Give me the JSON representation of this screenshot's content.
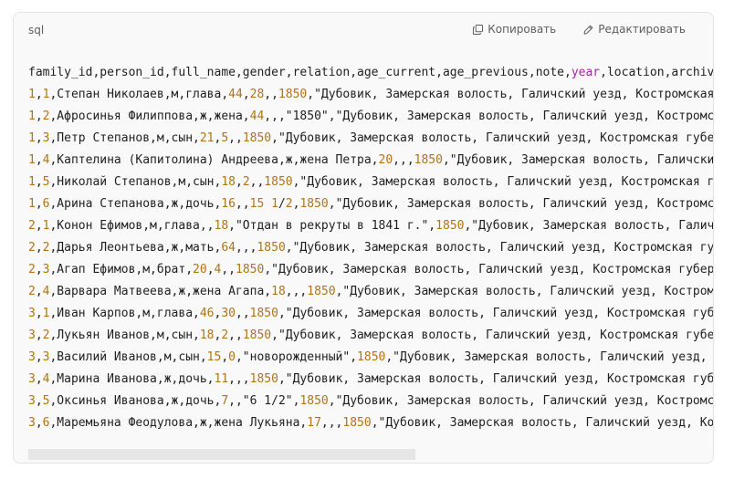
{
  "code_block": {
    "language": "sql",
    "copy_label": "Копировать",
    "edit_label": "Редактировать",
    "icons": {
      "copy": "copy-icon",
      "edit": "pencil-icon"
    },
    "colors": {
      "number": "#b07414",
      "keyword": "#a626a4",
      "text": "#1f1f1f"
    },
    "lines": [
      [
        {
          "t": "family_id,person_id,full_name,gender,relation,age_current,age_previous,note,"
        },
        {
          "t": "year",
          "k": "kw"
        },
        {
          "t": ",location,archive"
        }
      ],
      [
        {
          "t": "1",
          "k": "num"
        },
        {
          "t": ","
        },
        {
          "t": "1",
          "k": "num"
        },
        {
          "t": ",Степан Николаев,м,глава,"
        },
        {
          "t": "44",
          "k": "num"
        },
        {
          "t": ","
        },
        {
          "t": "28",
          "k": "num"
        },
        {
          "t": ",,"
        },
        {
          "t": "1850",
          "k": "num"
        },
        {
          "t": ",\"Дубовик, Замерская волость, Галичский уезд, Костромская г"
        }
      ],
      [
        {
          "t": "1",
          "k": "num"
        },
        {
          "t": ","
        },
        {
          "t": "2",
          "k": "num"
        },
        {
          "t": ",Афросинья Филиппова,ж,жена,"
        },
        {
          "t": "44",
          "k": "num"
        },
        {
          "t": ",,,\"1850\",\"Дубовик, Замерская волость, Галичский уезд, Костромска"
        }
      ],
      [
        {
          "t": "1",
          "k": "num"
        },
        {
          "t": ","
        },
        {
          "t": "3",
          "k": "num"
        },
        {
          "t": ",Петр Степанов,м,сын,"
        },
        {
          "t": "21",
          "k": "num"
        },
        {
          "t": ","
        },
        {
          "t": "5",
          "k": "num"
        },
        {
          "t": ",,"
        },
        {
          "t": "1850",
          "k": "num"
        },
        {
          "t": ",\"Дубовик, Замерская волость, Галичский уезд, Костромская губер"
        }
      ],
      [
        {
          "t": "1",
          "k": "num"
        },
        {
          "t": ","
        },
        {
          "t": "4",
          "k": "num"
        },
        {
          "t": ",Каптелина (Капитолина) Андреева,ж,жена Петра,"
        },
        {
          "t": "20",
          "k": "num"
        },
        {
          "t": ",,,"
        },
        {
          "t": "1850",
          "k": "num"
        },
        {
          "t": ",\"Дубовик, Замерская волость, Галичский"
        }
      ],
      [
        {
          "t": "1",
          "k": "num"
        },
        {
          "t": ","
        },
        {
          "t": "5",
          "k": "num"
        },
        {
          "t": ",Николай Степанов,м,сын,"
        },
        {
          "t": "18",
          "k": "num"
        },
        {
          "t": ","
        },
        {
          "t": "2",
          "k": "num"
        },
        {
          "t": ",,"
        },
        {
          "t": "1850",
          "k": "num"
        },
        {
          "t": ",\"Дубовик, Замерская волость, Галичский уезд, Костромская губ"
        }
      ],
      [
        {
          "t": "1",
          "k": "num"
        },
        {
          "t": ","
        },
        {
          "t": "6",
          "k": "num"
        },
        {
          "t": ",Арина Степанова,ж,дочь,"
        },
        {
          "t": "16",
          "k": "num"
        },
        {
          "t": ",,"
        },
        {
          "t": "15",
          "k": "num"
        },
        {
          "t": " "
        },
        {
          "t": "1",
          "k": "num"
        },
        {
          "t": "/"
        },
        {
          "t": "2",
          "k": "num"
        },
        {
          "t": ","
        },
        {
          "t": "1850",
          "k": "num"
        },
        {
          "t": ",\"Дубовик, Замерская волость, Галичский уезд, Костромск"
        }
      ],
      [
        {
          "t": "2",
          "k": "num"
        },
        {
          "t": ","
        },
        {
          "t": "1",
          "k": "num"
        },
        {
          "t": ",Конон Ефимов,м,глава,,"
        },
        {
          "t": "18",
          "k": "num"
        },
        {
          "t": ",\"Отдан в рекруты в 1841 г.\","
        },
        {
          "t": "1850",
          "k": "num"
        },
        {
          "t": ",\"Дубовик, Замерская волость, Галичс"
        }
      ],
      [
        {
          "t": "2",
          "k": "num"
        },
        {
          "t": ","
        },
        {
          "t": "2",
          "k": "num"
        },
        {
          "t": ",Дарья Леонтьева,ж,мать,"
        },
        {
          "t": "64",
          "k": "num"
        },
        {
          "t": ",,,"
        },
        {
          "t": "1850",
          "k": "num"
        },
        {
          "t": ",\"Дубовик, Замерская волость, Галичский уезд, Костромская губе"
        }
      ],
      [
        {
          "t": "2",
          "k": "num"
        },
        {
          "t": ","
        },
        {
          "t": "3",
          "k": "num"
        },
        {
          "t": ",Агап Ефимов,м,брат,"
        },
        {
          "t": "20",
          "k": "num"
        },
        {
          "t": ","
        },
        {
          "t": "4",
          "k": "num"
        },
        {
          "t": ",,"
        },
        {
          "t": "1850",
          "k": "num"
        },
        {
          "t": ",\"Дубовик, Замерская волость, Галичский уезд, Костромская губерн"
        }
      ],
      [
        {
          "t": "2",
          "k": "num"
        },
        {
          "t": ","
        },
        {
          "t": "4",
          "k": "num"
        },
        {
          "t": ",Варвара Матвеева,ж,жена Агапа,"
        },
        {
          "t": "18",
          "k": "num"
        },
        {
          "t": ",,,"
        },
        {
          "t": "1850",
          "k": "num"
        },
        {
          "t": ",\"Дубовик, Замерская волость, Галичский уезд, Костромск"
        }
      ],
      [
        {
          "t": "3",
          "k": "num"
        },
        {
          "t": ","
        },
        {
          "t": "1",
          "k": "num"
        },
        {
          "t": ",Иван Карпов,м,глава,"
        },
        {
          "t": "46",
          "k": "num"
        },
        {
          "t": ","
        },
        {
          "t": "30",
          "k": "num"
        },
        {
          "t": ",,"
        },
        {
          "t": "1850",
          "k": "num"
        },
        {
          "t": ",\"Дубовик, Замерская волость, Галичский уезд, Костромская губер"
        }
      ],
      [
        {
          "t": "3",
          "k": "num"
        },
        {
          "t": ","
        },
        {
          "t": "2",
          "k": "num"
        },
        {
          "t": ",Лукьян Иванов,м,сын,"
        },
        {
          "t": "18",
          "k": "num"
        },
        {
          "t": ","
        },
        {
          "t": "2",
          "k": "num"
        },
        {
          "t": ",,"
        },
        {
          "t": "1850",
          "k": "num"
        },
        {
          "t": ",\"Дубовик, Замерская волость, Галичский уезд, Костромская губер"
        }
      ],
      [
        {
          "t": "3",
          "k": "num"
        },
        {
          "t": ","
        },
        {
          "t": "3",
          "k": "num"
        },
        {
          "t": ",Василий Иванов,м,сын,"
        },
        {
          "t": "15",
          "k": "num"
        },
        {
          "t": ","
        },
        {
          "t": "0",
          "k": "num"
        },
        {
          "t": ",\"новорожденный\","
        },
        {
          "t": "1850",
          "k": "num"
        },
        {
          "t": ",\"Дубовик, Замерская волость, Галичский уезд, Ко"
        }
      ],
      [
        {
          "t": "3",
          "k": "num"
        },
        {
          "t": ","
        },
        {
          "t": "4",
          "k": "num"
        },
        {
          "t": ",Марина Иванова,ж,дочь,"
        },
        {
          "t": "11",
          "k": "num"
        },
        {
          "t": ",,,"
        },
        {
          "t": "1850",
          "k": "num"
        },
        {
          "t": ",\"Дубовик, Замерская волость, Галичский уезд, Костромская губер"
        }
      ],
      [
        {
          "t": "3",
          "k": "num"
        },
        {
          "t": ","
        },
        {
          "t": "5",
          "k": "num"
        },
        {
          "t": ",Оксинья Иванова,ж,дочь,"
        },
        {
          "t": "7",
          "k": "num"
        },
        {
          "t": ",,\"6 1/2\","
        },
        {
          "t": "1850",
          "k": "num"
        },
        {
          "t": ",\"Дубовик, Замерская волость, Галичский уезд, Костромская"
        }
      ],
      [
        {
          "t": "3",
          "k": "num"
        },
        {
          "t": ","
        },
        {
          "t": "6",
          "k": "num"
        },
        {
          "t": ",Маремьяна Феодулова,ж,жена Лукьяна,"
        },
        {
          "t": "17",
          "k": "num"
        },
        {
          "t": ",,,"
        },
        {
          "t": "1850",
          "k": "num"
        },
        {
          "t": ",\"Дубовик, Замерская волость, Галичский уезд, Кост"
        }
      ]
    ],
    "horizontal_scroll_position": 0
  }
}
